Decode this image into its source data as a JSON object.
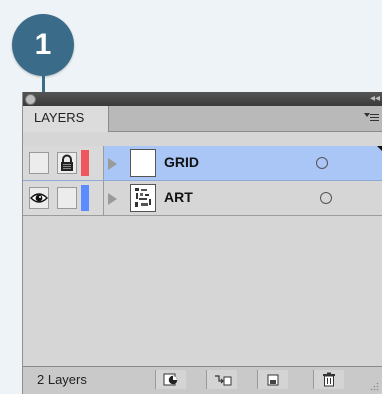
{
  "callout": {
    "number": "1"
  },
  "panel": {
    "tab_label": "LAYERS",
    "layers": [
      {
        "name": "GRID",
        "selected": true,
        "visible": false,
        "locked": true,
        "color": "#f0545c"
      },
      {
        "name": "ART",
        "selected": false,
        "visible": true,
        "locked": false,
        "color": "#5b8cff"
      }
    ],
    "footer": {
      "count_label": "2 Layers",
      "buttons": [
        "make-clipping-mask-icon",
        "create-sublayer-icon",
        "create-layer-icon",
        "trash-icon"
      ]
    }
  }
}
